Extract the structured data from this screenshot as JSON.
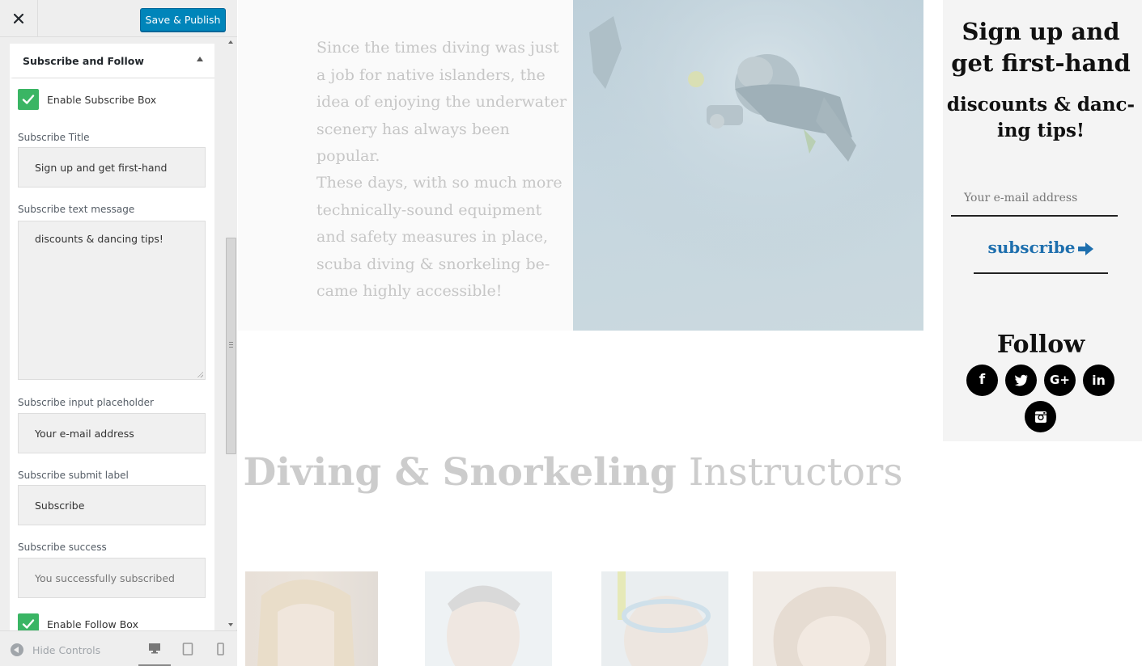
{
  "customizer": {
    "close_icon": "close-icon",
    "save_button": "Save & Publish",
    "accent_color": "#0085ba",
    "section": {
      "title": "Subscribe and Follow",
      "enable_subscribe_label": "Enable Subscribe Box",
      "enable_subscribe_checked": true,
      "fields": {
        "title_label": "Subscribe Title",
        "title_value": "Sign up and get first-hand",
        "message_label": "Subscribe text message",
        "message_value": "discounts & dancing tips!",
        "placeholder_label": "Subscribe input placeholder",
        "placeholder_value": "Your e-mail address",
        "submit_label": "Subscribe submit label",
        "submit_value": "Subscribe",
        "success_label": "Subscribe success",
        "success_value": "You successfully subscribed"
      },
      "enable_follow_label": "Enable Follow Box",
      "enable_follow_checked": true
    },
    "footer": {
      "hide_controls_label": "Hide Controls",
      "devices": [
        "desktop",
        "tablet",
        "mobile"
      ],
      "active_device": "desktop"
    }
  },
  "preview": {
    "intro_paragraphs": [
      "Since the times diving was just a job for native islanders, the idea of enjoying the underwater scenery has always been popular.",
      "These days, with so much more technically-sound equipment and safety measures in place, scuba diving & snorkeling be-came highly accessible!"
    ],
    "instructors_title_bold": "Diving & Snorkeling",
    "instructors_title_light": "Instructors",
    "subscribe_widget": {
      "title": "Sign up and get first-hand",
      "message": "discounts & danc-ing tips!",
      "input_placeholder": "Your e-mail address",
      "button_label": "subscribe",
      "button_color": "#1e6fae"
    },
    "follow": {
      "title": "Follow",
      "networks": [
        {
          "name": "facebook",
          "glyph": "f"
        },
        {
          "name": "twitter",
          "glyph": "t"
        },
        {
          "name": "google-plus",
          "glyph": "G+"
        },
        {
          "name": "linkedin",
          "glyph": "in"
        },
        {
          "name": "instagram",
          "glyph": ""
        }
      ]
    }
  }
}
